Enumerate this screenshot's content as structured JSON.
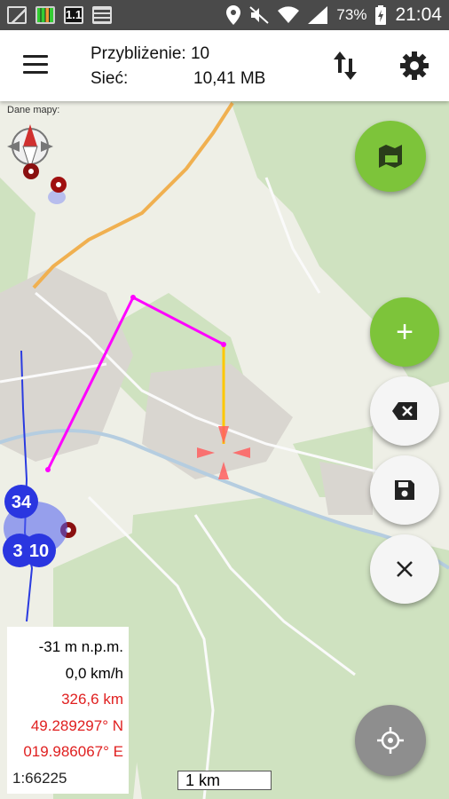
{
  "status_bar": {
    "left_icons": [
      "picture-icon",
      "equalizer-icon",
      "app-1-1-icon",
      "list-icon"
    ],
    "right_icons": [
      "location-icon",
      "mute-icon",
      "wifi-icon",
      "signal-icon",
      "battery-charging-icon"
    ],
    "battery": "73%",
    "time": "21:04"
  },
  "appbar": {
    "menu_icon": "hamburger-icon",
    "zoom_label": "Przybliżenie: 10",
    "network_label": "Sieć:",
    "network_value": "10,41 MB",
    "swap_icon": "swap-vertical-icon",
    "settings_icon": "gear-icon"
  },
  "map": {
    "source_label": "Dane mapy:",
    "clusters": [
      "34",
      "3",
      "10"
    ],
    "scale_bar": "1 km",
    "colors": {
      "track": "#ff00ff",
      "segment": "#ffc800",
      "crosshair": "#ff5050",
      "road": "#ffb347"
    }
  },
  "buttons": {
    "rec": "rec-map-icon",
    "add": "+",
    "delete": "backspace-icon",
    "save": "save-icon",
    "close": "close-icon",
    "locate": "crosshair-locate-icon"
  },
  "info": {
    "altitude": "-31 m n.p.m.",
    "speed": "0,0 km/h",
    "distance": "326,6 km",
    "lat": "49.289297° N",
    "lon": "019.986067° E",
    "scale": "1:66225"
  }
}
